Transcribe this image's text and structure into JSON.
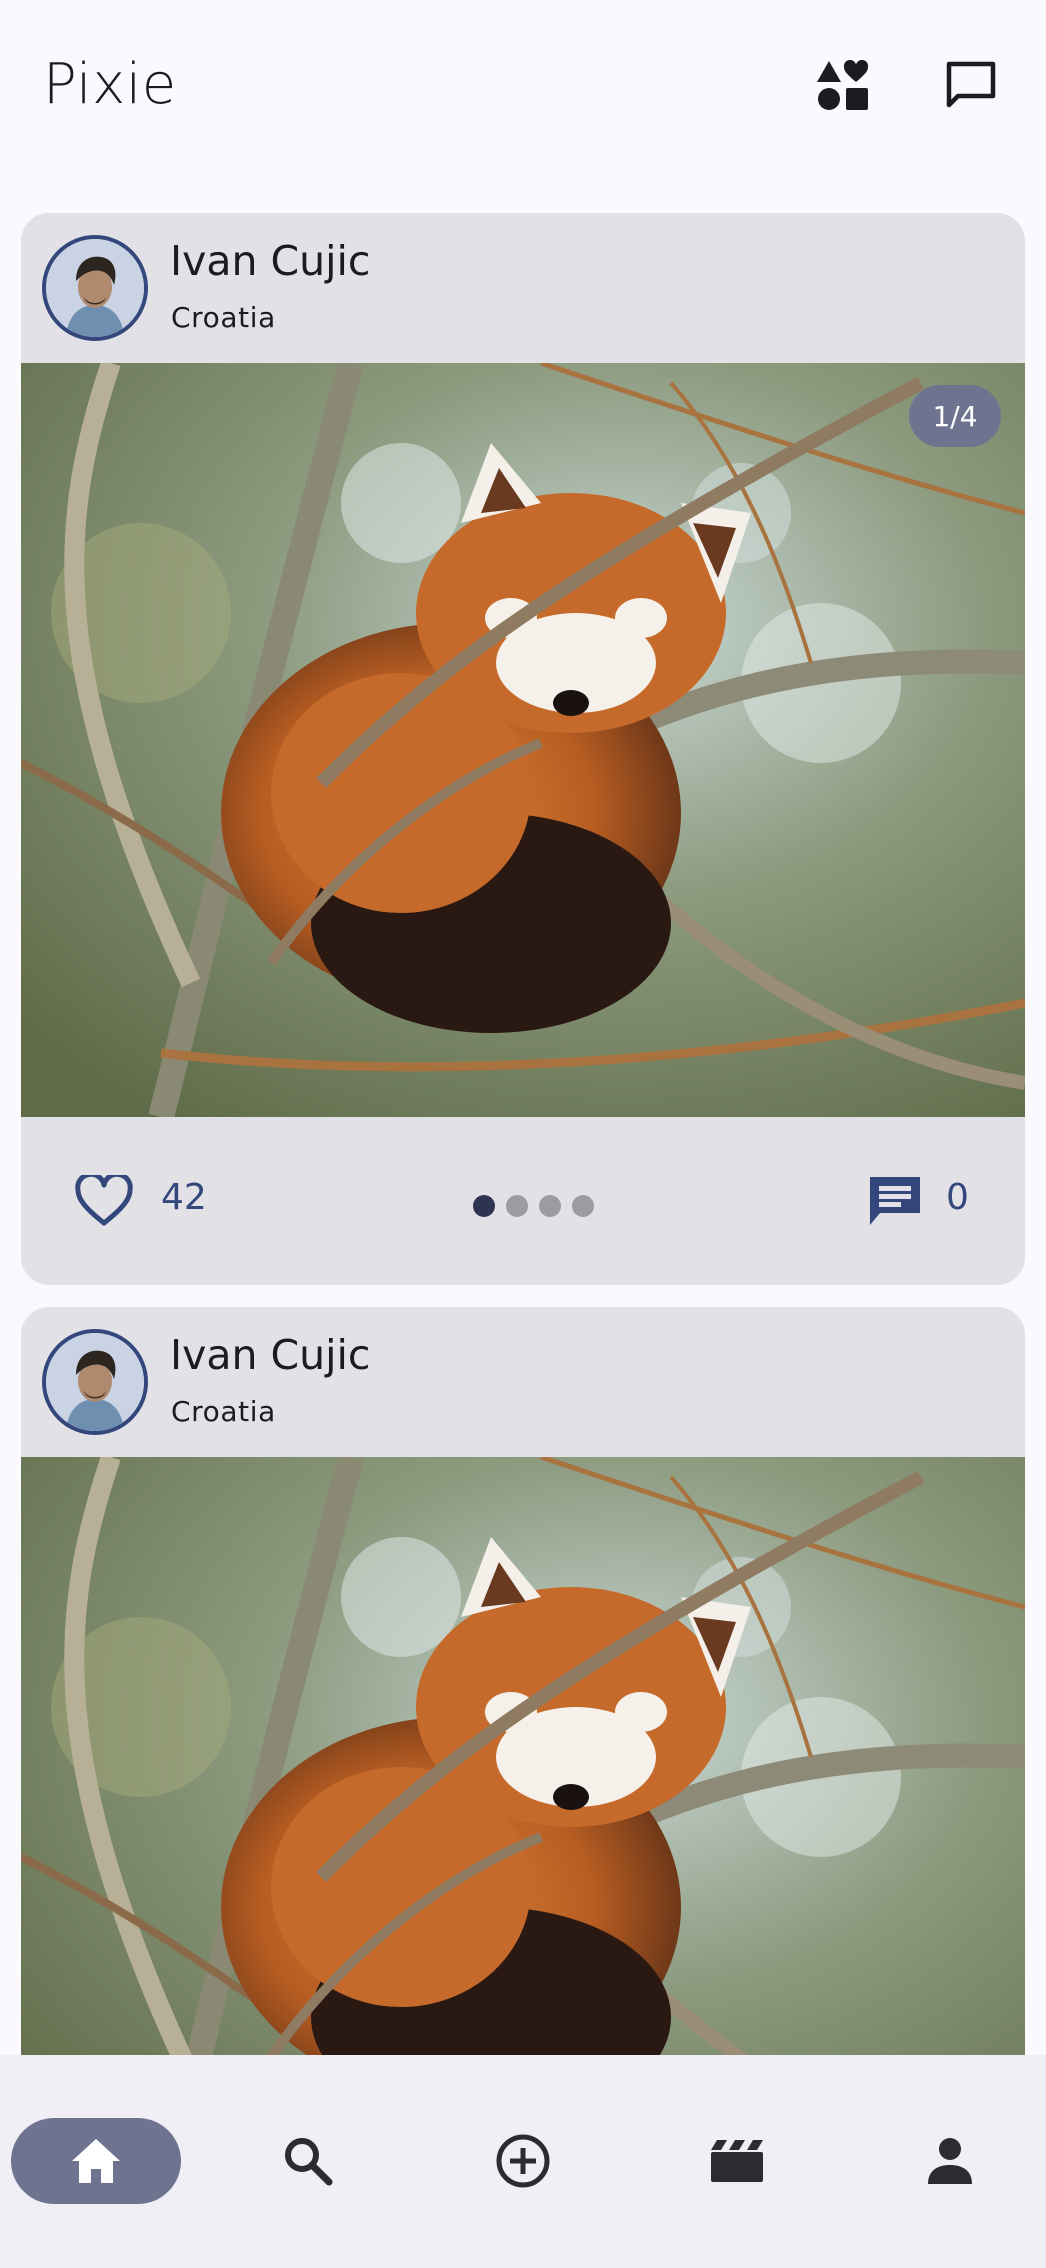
{
  "app": {
    "title": "Pixie"
  },
  "top_actions": {
    "left_icon": "shapes-icon",
    "right_icon": "chat-bubble-icon"
  },
  "posts": [
    {
      "user": {
        "name": "Ivan Cujic",
        "location": "Croatia"
      },
      "photo": {
        "counter": "1/4"
      },
      "likes": "42",
      "comments": "0",
      "carousel": {
        "total": 4,
        "active": 1
      }
    },
    {
      "user": {
        "name": "Ivan Cujic",
        "location": "Croatia"
      }
    }
  ],
  "bottom_nav": {
    "items": [
      {
        "icon": "home-icon",
        "active": true
      },
      {
        "icon": "search-icon",
        "active": false
      },
      {
        "icon": "add-circle-icon",
        "active": false
      },
      {
        "icon": "clapperboard-icon",
        "active": false
      },
      {
        "icon": "person-icon",
        "active": false
      }
    ]
  },
  "colors": {
    "background": "#f9f9fe",
    "card": "#e2e2e6",
    "accent": "#34477d",
    "active_pill": "#6e7490",
    "nav_bar": "#efeff5"
  }
}
